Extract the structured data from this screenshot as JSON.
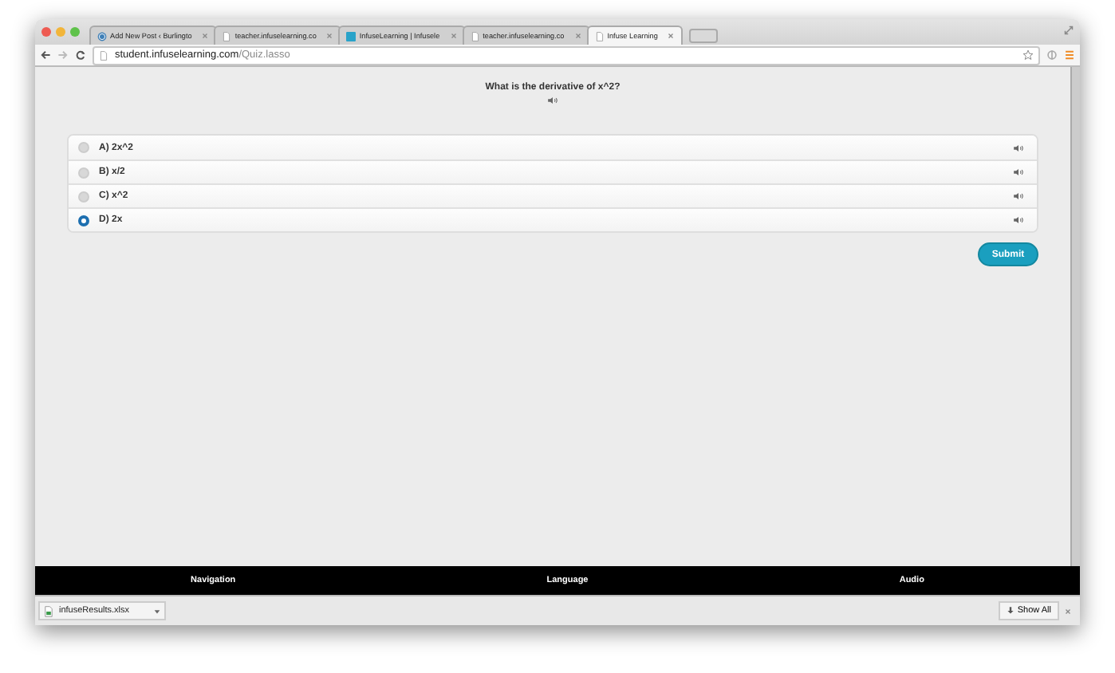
{
  "tabs": [
    {
      "title": "Add New Post ‹ Burlingto",
      "kind": "globe",
      "selected": false
    },
    {
      "title": "teacher.infuselearning.co",
      "kind": "page",
      "selected": false
    },
    {
      "title": "InfuseLearning | Infusele",
      "kind": "site",
      "selected": false
    },
    {
      "title": "teacher.infuselearning.co",
      "kind": "page",
      "selected": false
    },
    {
      "title": "Infuse Learning",
      "kind": "page",
      "selected": true
    }
  ],
  "address_bar": {
    "host": "student.infuselearning.com",
    "path": "/Quiz.lasso"
  },
  "question": {
    "text": "What is the derivative of x^2?"
  },
  "answers": [
    {
      "label": "A) 2x^2",
      "selected": false
    },
    {
      "label": "B) x/2",
      "selected": false
    },
    {
      "label": "C) x^2",
      "selected": false
    },
    {
      "label": "D) 2x",
      "selected": true
    }
  ],
  "submit_button": "Submit",
  "footer": [
    "Navigation",
    "Language",
    "Audio"
  ],
  "download_bar": {
    "file": "infuseResults.xlsx",
    "show_all": "Show All"
  }
}
